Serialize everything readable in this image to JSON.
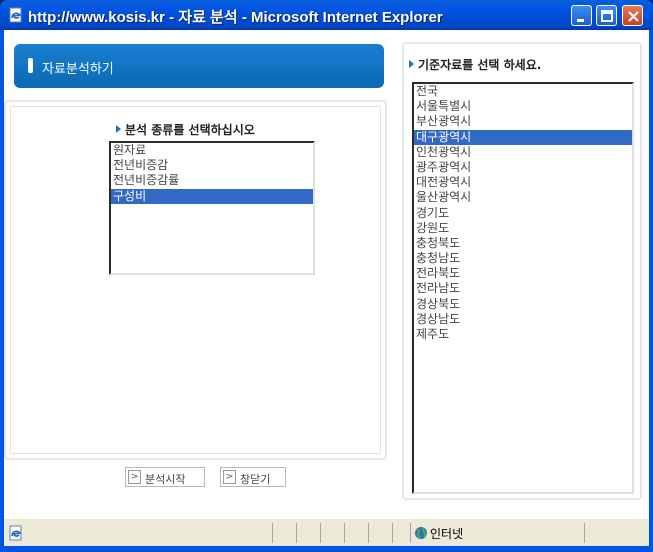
{
  "window": {
    "title": "http://www.kosis.kr - 자료 분석 - Microsoft Internet Explorer"
  },
  "left": {
    "header": "자료분석하기",
    "prompt": "분석 종류를 선택하십시오",
    "options": [
      "원자료",
      "전년비증감",
      "전년비증감률",
      "구성비"
    ],
    "selected": "구성비",
    "buttons": {
      "start": "분석시작",
      "close": "창닫기"
    }
  },
  "right": {
    "prompt": "기준자료를 선택 하세요.",
    "options": [
      "전국",
      "서울특별시",
      "부산광역시",
      "대구광역시",
      "인천광역시",
      "광주광역시",
      "대전광역시",
      "울산광역시",
      "경기도",
      "강원도",
      "충청북도",
      "충청남도",
      "전라북도",
      "전라남도",
      "경상북도",
      "경상남도",
      "제주도"
    ],
    "selected": "대구광역시"
  },
  "statusbar": {
    "zone": "인터넷"
  },
  "colors": {
    "titlebar": "#0054e3",
    "header": "#0b69b6",
    "selection": "#316ac5"
  }
}
